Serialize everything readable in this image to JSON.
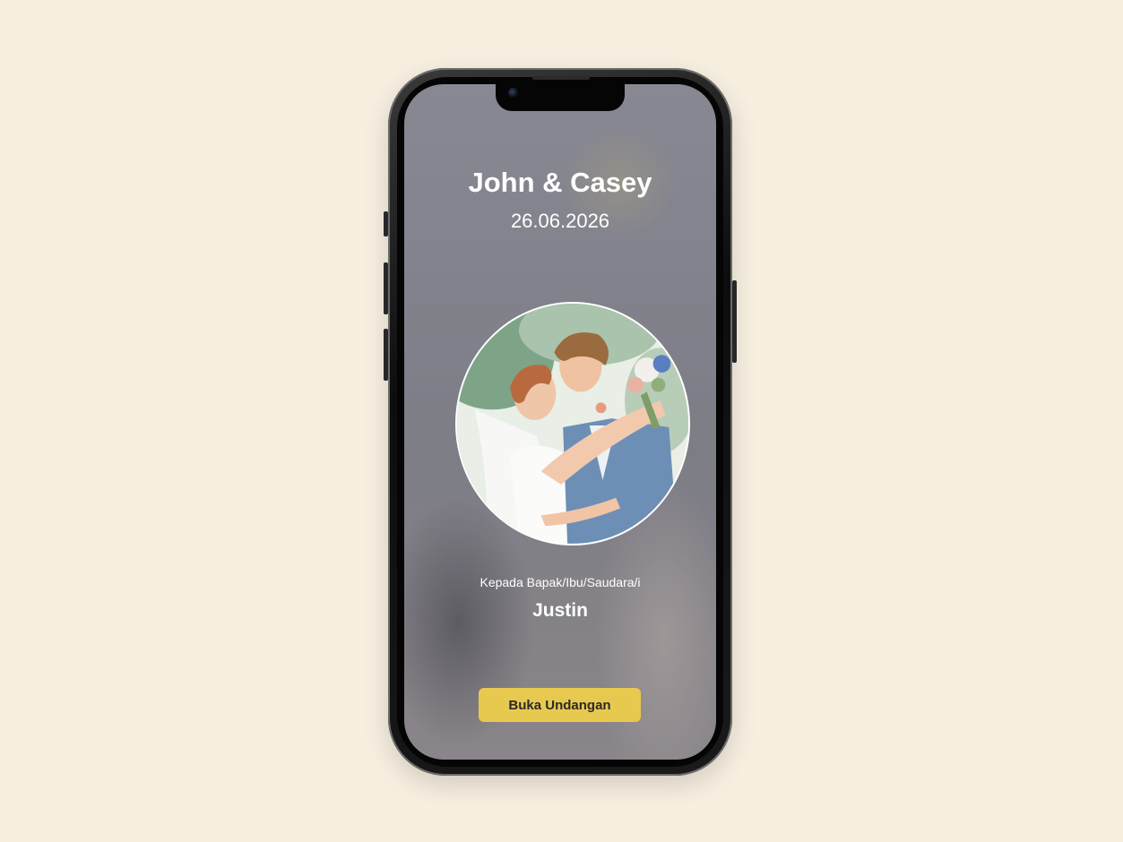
{
  "invitation": {
    "couple_names": "John & Casey",
    "date": "26.06.2026",
    "recipient_label": "Kepada Bapak/Ibu/Saudara/i",
    "recipient_name": "Justin",
    "open_button_label": "Buka Undangan",
    "photo": "couple-photo"
  },
  "colors": {
    "page_background": "#f7efe0",
    "button_background": "#e8c94f",
    "text": "#ffffff"
  }
}
